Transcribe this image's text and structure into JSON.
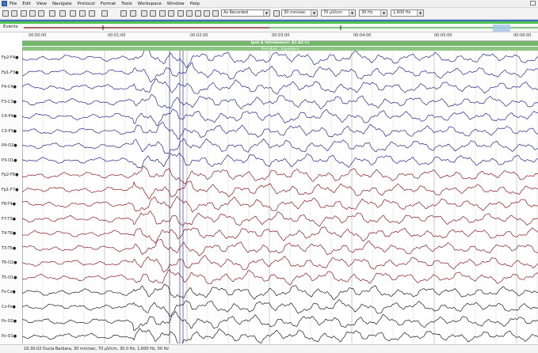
{
  "menu": [
    "File",
    "Edit",
    "View",
    "Navigate",
    "Protocol",
    "Format",
    "Tools",
    "Workspace",
    "Window",
    "Help"
  ],
  "toolbar": {
    "recording_mode": "As Recorded",
    "speed": "30 mm/sec",
    "sensitivity": "70 µV/cm",
    "low_filter": "30 Hz",
    "high_filter": "1,600 Hz"
  },
  "events_label": "Events",
  "time_ticks": [
    "00:00:00",
    "00:01:00",
    "00:02:00",
    "00:03:00",
    "00:04:00",
    "00:05:00",
    "00:06:00"
  ],
  "montage_title": "Ipsil & Intrahem(e)- A1 A2 Cz",
  "montage_sub": "Procedure... Impedance",
  "channels": [
    {
      "label": "Fp2-F4●",
      "group": "blue"
    },
    {
      "label": "Fp1-F3●",
      "group": "blue"
    },
    {
      "label": "F4-C4●",
      "group": "blue"
    },
    {
      "label": "F3-C3●",
      "group": "blue"
    },
    {
      "label": "C4-P4●",
      "group": "blue"
    },
    {
      "label": "C3-P3●",
      "group": "blue"
    },
    {
      "label": "P4-O2●",
      "group": "blue"
    },
    {
      "label": "P3-O1●",
      "group": "blue"
    },
    {
      "label": "Fp2-F8●",
      "group": "red"
    },
    {
      "label": "Fp1-F7●",
      "group": "red"
    },
    {
      "label": "F8-T4●",
      "group": "red"
    },
    {
      "label": "F7-T3●",
      "group": "red"
    },
    {
      "label": "T4-T6●",
      "group": "red"
    },
    {
      "label": "T3-T5●",
      "group": "red"
    },
    {
      "label": "T6-O2●",
      "group": "red"
    },
    {
      "label": "T5-O1●",
      "group": "red"
    },
    {
      "label": "Fz-Cz●",
      "group": "black"
    },
    {
      "label": "Cz-Pz●",
      "group": "black"
    },
    {
      "label": "Pz-O2●",
      "group": "black"
    },
    {
      "label": "Pz-O1●",
      "group": "black"
    }
  ],
  "colors": {
    "blue": "#1f2a8c",
    "red": "#8b1a1a",
    "black": "#1a1a1a"
  },
  "status": "16:30:02 Ducia Barbara, 30 mm/sec, 70 µV/cm, 30.0 Hz, 1,600 Hz, 50 Hz"
}
